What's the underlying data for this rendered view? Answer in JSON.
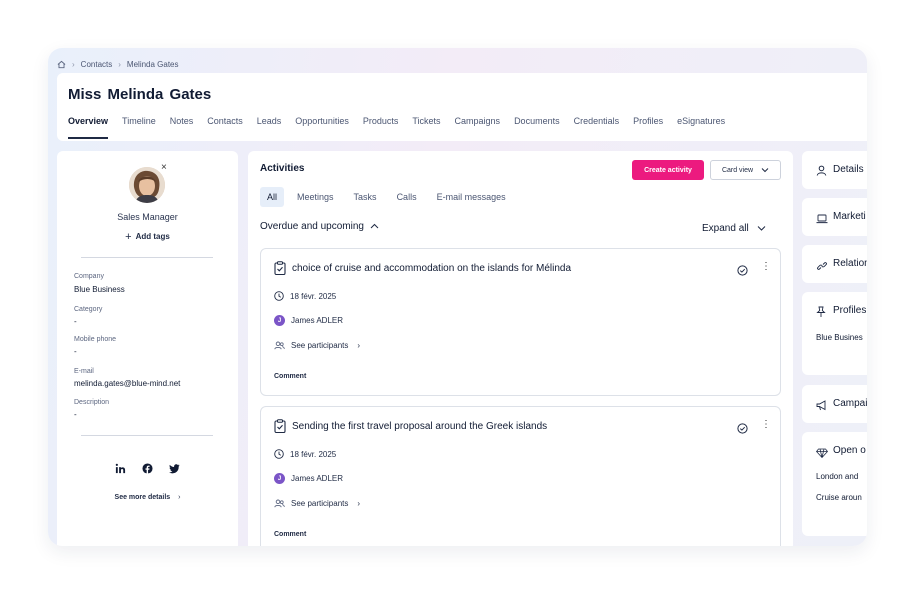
{
  "breadcrumb": {
    "items": [
      "Contacts",
      "Melinda Gates"
    ]
  },
  "contact": {
    "title": "Miss  Melinda  Gates",
    "role": "Sales Manager",
    "add_tags": "Add tags",
    "fields": [
      {
        "label": "Company",
        "value": "Blue Business"
      },
      {
        "label": "Category",
        "value": "-"
      },
      {
        "label": "Mobile phone",
        "value": "-"
      },
      {
        "label": "E-mail",
        "value": "melinda.gates@blue-mind.net"
      },
      {
        "label": "Description",
        "value": "-"
      }
    ],
    "social": [
      "linkedin-icon",
      "facebook-icon",
      "twitter-icon"
    ],
    "see_more": "See more details"
  },
  "tabs": [
    "Overview",
    "Timeline",
    "Notes",
    "Contacts",
    "Leads",
    "Opportunities",
    "Products",
    "Tickets",
    "Campaigns",
    "Documents",
    "Credentials",
    "Profiles",
    "eSignatures"
  ],
  "activities": {
    "title": "Activities",
    "create_button": "Create activity",
    "view_button": "Card view",
    "filters": [
      "All",
      "Meetings",
      "Tasks",
      "Calls",
      "E-mail messages"
    ],
    "section": "Overdue and upcoming",
    "expand": "Expand all",
    "items": [
      {
        "title": "choice of cruise and accommodation on the islands for Mélinda",
        "date": "18 févr. 2025",
        "owner_initial": "J",
        "owner": "James ADLER",
        "participants": "See participants",
        "comment": "Comment"
      },
      {
        "title": "Sending the first travel proposal around the Greek islands",
        "date": "18 févr. 2025",
        "owner_initial": "J",
        "owner": "James ADLER",
        "participants": "See participants",
        "comment": "Comment"
      }
    ]
  },
  "right_panels": {
    "details": "Details",
    "marketing": "Marketi",
    "relations": "Relation",
    "profiles": "Profiles",
    "profiles_value": "Blue Busines",
    "campaigns": "Campai",
    "open": "Open o",
    "open_values": [
      "London and",
      "Cruise aroun"
    ]
  },
  "colors": {
    "accent": "#ec1a7f",
    "avatar_badge": "#7b55c7"
  }
}
